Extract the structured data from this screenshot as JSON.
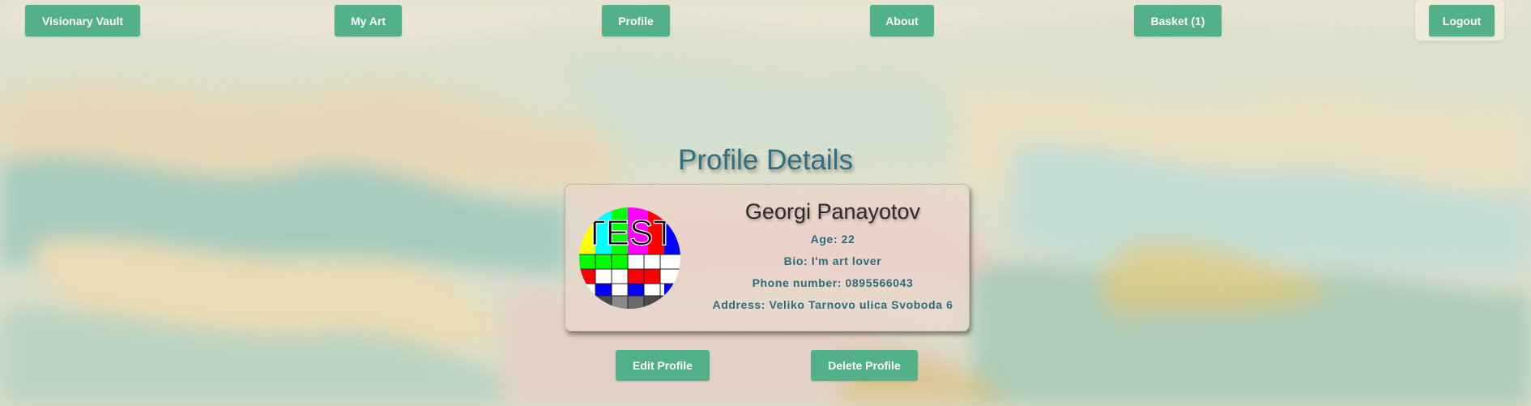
{
  "nav": {
    "brand": "Visionary Vault",
    "my_art": "My Art",
    "profile": "Profile",
    "about": "About",
    "basket": "Basket (1)",
    "logout": "Logout"
  },
  "page": {
    "title": "Profile Details"
  },
  "profile": {
    "name": "Georgi Panayotov",
    "age": "Age: 22",
    "bio": "Bio: I'm art lover",
    "phone": "Phone number: 0895566043",
    "address": "Address: Veliko Tarnovo ulica Svoboda 6",
    "avatar_text": "TEST"
  },
  "actions": {
    "edit": "Edit Profile",
    "delete": "Delete Profile"
  },
  "colors": {
    "accent": "#52b189",
    "title": "#2f6f86",
    "detail_text": "#2c6b7a"
  }
}
